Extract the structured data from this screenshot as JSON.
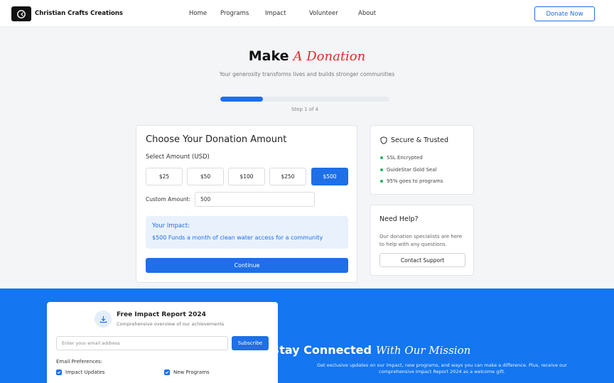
{
  "nav": {
    "brand": "Christian Crafts Creations",
    "links": [
      "Home",
      "Programs",
      "Impact",
      "Volunteer",
      "About"
    ],
    "donate_label": "Donate Now"
  },
  "hero": {
    "title_main": "Make",
    "title_script": "A Donation",
    "subtitle": "Your generosity transforms lives and builds stronger communities",
    "progress_fraction": 0.25,
    "step_label": "Step 1 of 4"
  },
  "donation": {
    "title": "Choose Your Donation Amount",
    "amount_label": "Select Amount (USD)",
    "amounts": [
      "$25",
      "$50",
      "$100",
      "$250",
      "$500"
    ],
    "selected_amount": "$500",
    "custom_label": "Custom Amount:",
    "custom_value": "500",
    "impact_title": "Your Impact:",
    "impact_text": "$500 Funds a month of clean water access for a community",
    "continue_label": "Continue"
  },
  "secure": {
    "title": "Secure & Trusted",
    "items": [
      "SSL Encrypted",
      "GuideStar Gold Seal",
      "95% goes to programs"
    ]
  },
  "help": {
    "title": "Need Help?",
    "text": "Our donation specialists are here to help with any questions.",
    "button_label": "Contact Support"
  },
  "report": {
    "title": "Free Impact Report 2024",
    "subtitle": "Comprehensive overview of our achievements",
    "email_placeholder": "Enter your email address",
    "subscribe_label": "Subscribe",
    "preferences_label": "Email Preferences:",
    "preferences": [
      {
        "label": "Impact Updates",
        "checked": true
      },
      {
        "label": "New Programs",
        "checked": true
      }
    ]
  },
  "stay": {
    "title_main": "Stay Connected",
    "title_script": "With Our Mission",
    "text": "Get exclusive updates on our impact, new programs, and ways you can make a difference. Plus, receive our comprehensive Impact Report 2024 as a welcome gift."
  },
  "colors": {
    "accent": "#1e6fe8",
    "script_red": "#e02b2b",
    "section_blue": "#1476f0",
    "trust_green": "#22b35e"
  }
}
